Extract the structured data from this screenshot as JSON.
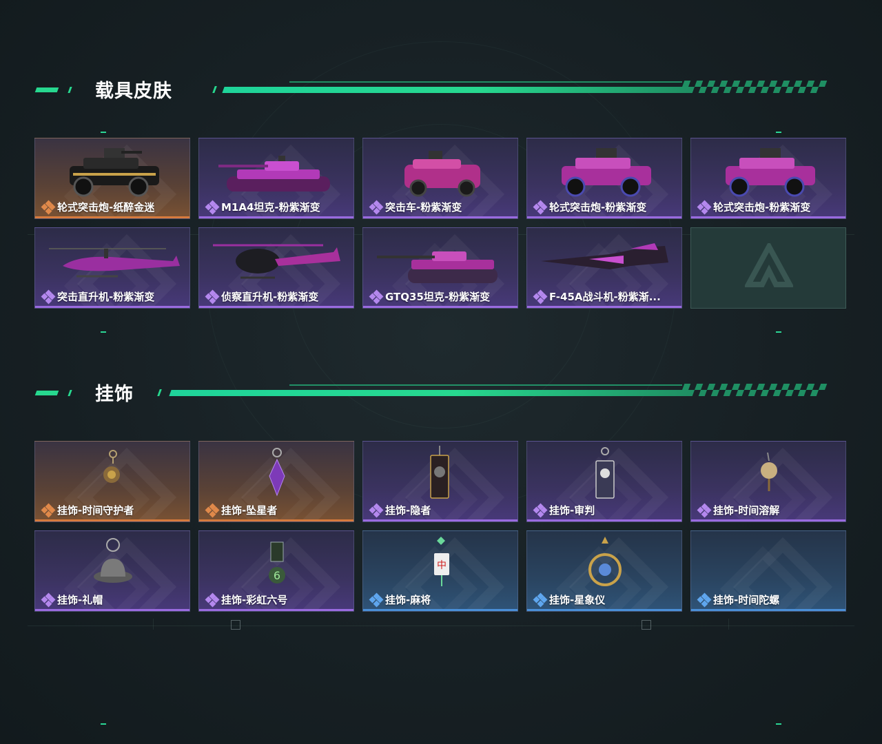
{
  "sections": [
    {
      "title": "载具皮肤",
      "items": [
        {
          "label": "轮式突击炮-纸醉金迷",
          "rarity": "orange",
          "icon": "wheeled-assault-gun-icon"
        },
        {
          "label": "M1A4坦克-粉紫渐变",
          "rarity": "purple",
          "icon": "tank-icon"
        },
        {
          "label": "突击车-粉紫渐变",
          "rarity": "purple",
          "icon": "assault-vehicle-icon"
        },
        {
          "label": "轮式突击炮-粉紫渐变",
          "rarity": "purple",
          "icon": "wheeled-assault-gun-icon"
        },
        {
          "label": "轮式突击炮-粉紫渐变",
          "rarity": "purple",
          "icon": "wheeled-assault-gun-icon"
        },
        {
          "label": "突击直升机-粉紫渐变",
          "rarity": "purple",
          "icon": "attack-helicopter-icon"
        },
        {
          "label": "侦察直升机-粉紫渐变",
          "rarity": "purple",
          "icon": "scout-helicopter-icon"
        },
        {
          "label": "GTQ35坦克-粉紫渐变",
          "rarity": "purple",
          "icon": "tank-icon"
        },
        {
          "label": "F-45A战斗机-粉紫渐...",
          "rarity": "purple",
          "icon": "fighter-jet-icon"
        },
        {
          "label": "",
          "rarity": "empty",
          "icon": "empty-slot-logo-icon"
        }
      ]
    },
    {
      "title": "挂饰",
      "items": [
        {
          "label": "挂饰-时间守护者",
          "rarity": "orange",
          "icon": "time-guardian-charm-icon"
        },
        {
          "label": "挂饰-坠星者",
          "rarity": "orange",
          "icon": "crystal-charm-icon"
        },
        {
          "label": "挂饰-隐者",
          "rarity": "purple",
          "icon": "hermit-card-charm-icon"
        },
        {
          "label": "挂饰-审判",
          "rarity": "purple",
          "icon": "judgement-card-charm-icon"
        },
        {
          "label": "挂饰-时间溶解",
          "rarity": "purple",
          "icon": "melting-clock-charm-icon"
        },
        {
          "label": "挂饰-礼帽",
          "rarity": "purple",
          "icon": "hat-charm-icon"
        },
        {
          "label": "挂饰-彩虹六号",
          "rarity": "purple",
          "icon": "rainbow-six-charm-icon"
        },
        {
          "label": "挂饰-麻将",
          "rarity": "blue",
          "icon": "mahjong-charm-icon"
        },
        {
          "label": "挂饰-星象仪",
          "rarity": "blue",
          "icon": "astrolabe-charm-icon"
        },
        {
          "label": "挂饰-时间陀螺",
          "rarity": "blue",
          "icon": "spinning-top-charm-icon"
        }
      ]
    }
  ],
  "colors": {
    "accent": "#27d88f",
    "rarity_orange": "#d77b3e",
    "rarity_purple": "#9a6be0",
    "rarity_blue": "#4a8fd8"
  }
}
